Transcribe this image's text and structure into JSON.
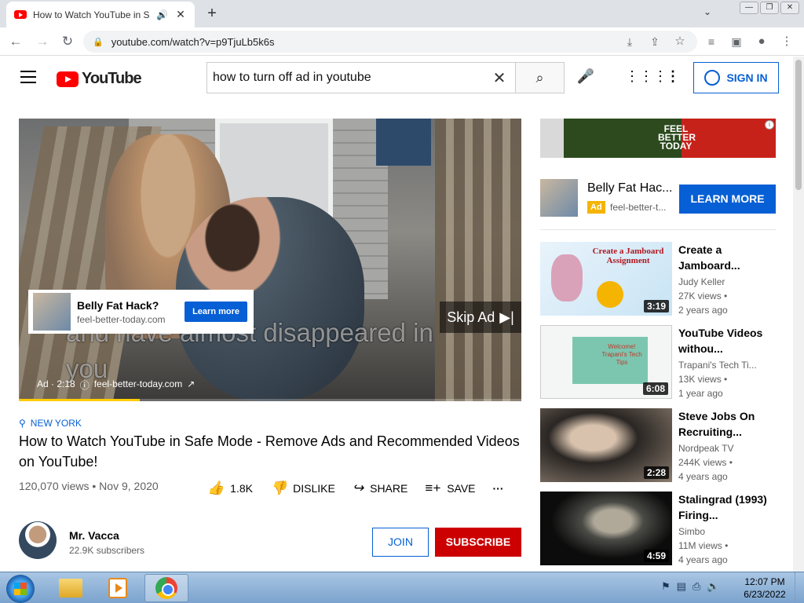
{
  "browser": {
    "tab_title": "How to Watch YouTube in Safe Mode - Remove Ads and Recommended Videos on YouTube!",
    "new_tab_glyph": "+",
    "url": "youtube.com/watch?v=p9TjuLb5k6s"
  },
  "header": {
    "logo_text": "YouTube",
    "search_value": "how to turn off ad in youtube",
    "signin_label": "SIGN IN"
  },
  "player": {
    "subtitle_line1": "and have almost disappeared in",
    "subtitle_line2": "you",
    "overlay_ad": {
      "title": "Belly Fat Hack?",
      "url": "feel-better-today.com",
      "button": "Learn more"
    },
    "skip_label": "Skip Ad",
    "ad_label": "Ad · 2:18",
    "ad_url": "feel-better-today.com",
    "progress_fraction": 0.24
  },
  "video": {
    "location": "NEW YORK",
    "title": "How to Watch YouTube in Safe Mode - Remove Ads and Recommended Videos on YouTube!",
    "views_date": "120,070 views • Nov 9, 2020",
    "likes": "1.8K",
    "dislike_label": "DISLIKE",
    "share_label": "SHARE",
    "save_label": "SAVE"
  },
  "channel": {
    "name": "Mr. Vacca",
    "subscribers": "22.9K subscribers",
    "join_label": "JOIN",
    "subscribe_label": "SUBSCRIBE"
  },
  "sidebar": {
    "banner_text": "FEEL BETTER TODAY",
    "ad": {
      "title": "Belly Fat Hac...",
      "badge": "Ad",
      "url": "feel-better-t...",
      "button": "LEARN MORE"
    },
    "recommendations": [
      {
        "title": "Create a Jamboard...",
        "channel": "Judy Keller",
        "views": "27K views •",
        "age": "2 years ago",
        "duration": "3:19",
        "thumb_text": "Create a Jamboard Assignment"
      },
      {
        "title": "YouTube Videos withou...",
        "channel": "Trapani's Tech Ti...",
        "views": "13K views •",
        "age": "1 year ago",
        "duration": "6:08",
        "thumb_text": "Welcome! Trapani's Tech Tips"
      },
      {
        "title": "Steve Jobs On Recruiting...",
        "channel": "Nordpeak TV",
        "views": "244K views •",
        "age": "4 years ago",
        "duration": "2:28"
      },
      {
        "title": "Stalingrad (1993) Firing...",
        "channel": "Simbo",
        "views": "11M views •",
        "age": "4 years ago",
        "duration": "4:59"
      }
    ]
  },
  "taskbar": {
    "time": "12:07 PM",
    "date": "6/23/2022"
  },
  "colors": {
    "youtube_red": "#ff0000",
    "link_blue": "#065fd4",
    "subscribe_red": "#cc0000",
    "ad_yellow": "#f4b400"
  }
}
